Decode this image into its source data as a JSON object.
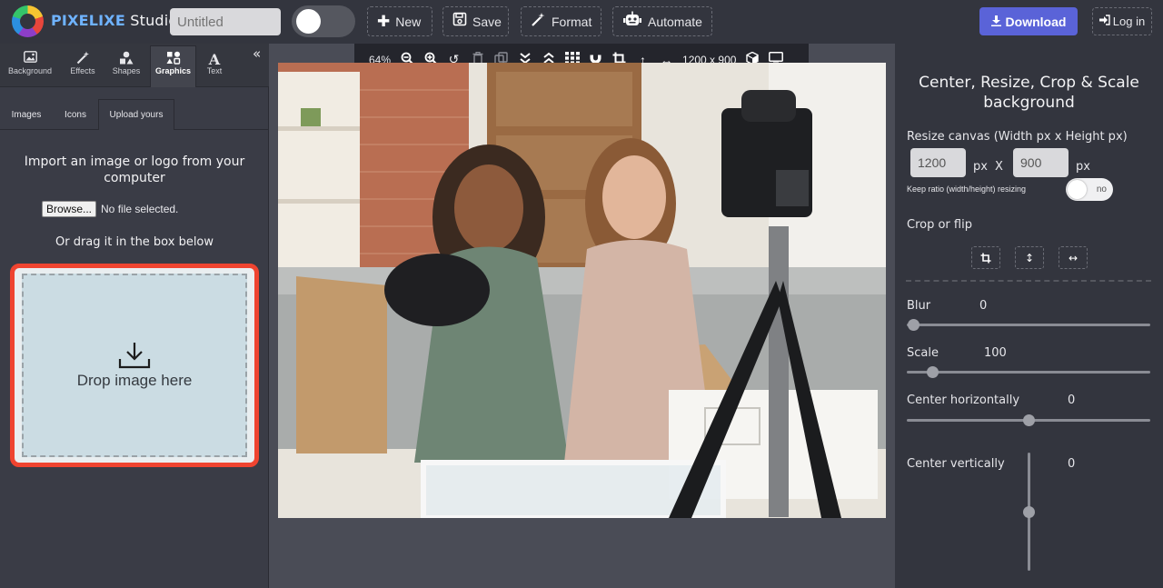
{
  "app": {
    "brand_name": "PIXELIXE",
    "brand_suffix": "Studio"
  },
  "document": {
    "title_placeholder": "Untitled"
  },
  "toolbar": {
    "new_label": "New",
    "save_label": "Save",
    "format_label": "Format",
    "automate_label": "Automate",
    "download_label": "Download",
    "login_label": "Log in"
  },
  "left_panel": {
    "categories": [
      {
        "label": "Background",
        "icon": "image-icon"
      },
      {
        "label": "Effects",
        "icon": "magic-wand-icon"
      },
      {
        "label": "Shapes",
        "icon": "shapes-icon"
      },
      {
        "label": "Graphics",
        "icon": "graphics-icon"
      },
      {
        "label": "Text",
        "icon": "text-icon"
      }
    ],
    "active_category": "Graphics",
    "sub_tabs": [
      "Images",
      "Icons",
      "Upload yours"
    ],
    "active_sub_tab": "Upload yours",
    "import_text": "Import an image or logo from your computer",
    "browse_label": "Browse...",
    "no_file_text": "No file selected.",
    "drag_text": "Or drag it in the box below",
    "drop_label": "Drop image here"
  },
  "canvas_toolbar": {
    "zoom": "64%",
    "dimensions": "1200 x 900",
    "icons": [
      "zoom-out-icon",
      "zoom-in-icon",
      "undo-icon",
      "trash-icon",
      "duplicate-icon",
      "send-backward-icon",
      "bring-forward-icon",
      "grid-icon",
      "magnet-icon",
      "crop-icon",
      "vertical-resize-icon",
      "horizontal-resize-icon",
      "3d-box-icon",
      "monitor-icon"
    ]
  },
  "right_panel": {
    "title": "Center, Resize, Crop & Scale background",
    "resize_label": "Resize canvas (Width px x Height px)",
    "width_value": "1200",
    "height_value": "900",
    "px_label": "px",
    "x_label": "X",
    "keep_ratio_label": "Keep ratio (width/height) resizing",
    "keep_ratio_state": "no",
    "crop_flip_label": "Crop or flip",
    "blur_label": "Blur",
    "blur_value": "0",
    "scale_label": "Scale",
    "scale_value": "100",
    "center_h_label": "Center horizontally",
    "center_h_value": "0",
    "center_v_label": "Center vertically",
    "center_v_value": "0"
  },
  "colors": {
    "accent": "#5a63d8",
    "brand_blue": "#6fb3ff",
    "drop_border": "#ef4430",
    "background": "#3a3c46"
  }
}
